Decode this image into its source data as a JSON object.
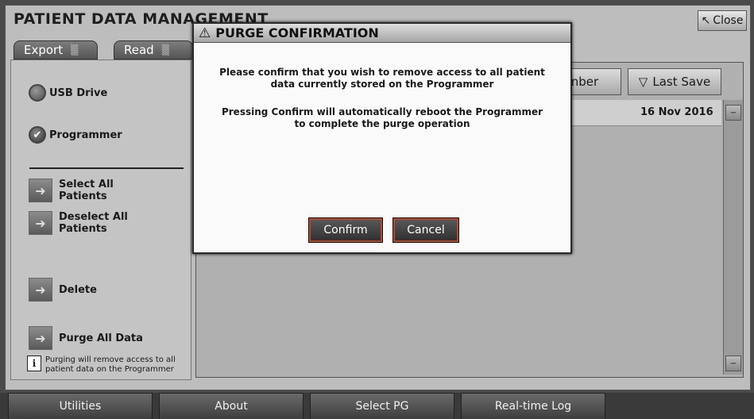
{
  "app": {
    "title": "PATIENT DATA MANAGEMENT",
    "close_label": "Close"
  },
  "tabs": [
    {
      "label": "Export"
    },
    {
      "label": "Read"
    }
  ],
  "left_panel": {
    "radios": [
      {
        "label": "USB Drive",
        "checked": false
      },
      {
        "label": "Programmer",
        "checked": true
      }
    ],
    "actions": [
      {
        "label": "Select All\nPatients"
      },
      {
        "label": "Deselect All\nPatients"
      },
      {
        "label": "Delete"
      },
      {
        "label": "Purge All Data"
      }
    ],
    "info_text": "Purging will remove access to all\npatient data on the Programmer"
  },
  "table": {
    "columns": [
      {
        "label": "nber"
      },
      {
        "label": "Last Save",
        "sort_icon": "sort-down-icon"
      }
    ],
    "rows": [
      {
        "last_save": "16 Nov 2016"
      }
    ]
  },
  "footer_tabs": [
    {
      "label": "Utilities"
    },
    {
      "label": "About"
    },
    {
      "label": "Select PG"
    },
    {
      "label": "Real-time Log"
    }
  ],
  "dialog": {
    "title": "PURGE CONFIRMATION",
    "message1": "Please confirm that you wish to remove access to all patient\ndata currently stored on the Programmer",
    "message2": "Pressing Confirm will automatically reboot the Programmer\nto complete the purge operation",
    "confirm_label": "Confirm",
    "cancel_label": "Cancel"
  }
}
